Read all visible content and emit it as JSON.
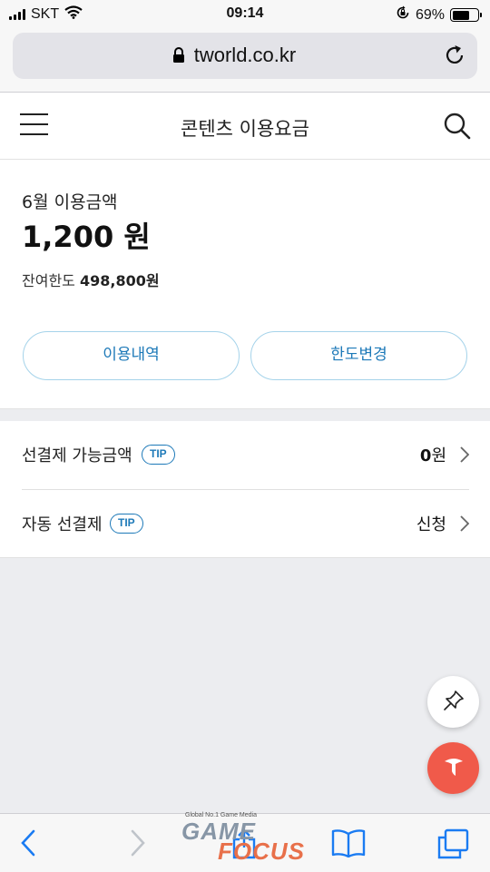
{
  "status_bar": {
    "carrier": "SKT",
    "time": "09:14",
    "battery_percent": "69%",
    "battery_level": 0.69,
    "icons": [
      "signal-icon",
      "wifi-icon",
      "rotation-lock-icon",
      "battery-icon"
    ]
  },
  "browser": {
    "url": "tworld.co.kr",
    "icons": [
      "lock-icon",
      "reload-icon"
    ]
  },
  "header": {
    "title": "콘텐츠 이용요금",
    "icons": [
      "menu-icon",
      "search-icon"
    ]
  },
  "usage": {
    "month_label": "6월 이용금액",
    "amount": "1,200 원",
    "remaining_label": "잔여한도",
    "remaining_value": "498,800원",
    "history_button": "이용내역",
    "limit_button": "한도변경"
  },
  "list": {
    "rows": [
      {
        "label": "선결제 가능금액",
        "badge": "TIP",
        "value_strong": "0",
        "value_unit": "원"
      },
      {
        "label": "자동 선결제",
        "badge": "TIP",
        "value_strong": "",
        "value_unit": "신청"
      }
    ]
  },
  "floating": {
    "icons": [
      "pin-icon",
      "tworld-logo-icon"
    ]
  },
  "toolbar": {
    "icons": [
      "back-icon",
      "forward-icon",
      "share-icon",
      "bookmarks-icon",
      "tabs-icon"
    ]
  },
  "watermark": {
    "tagline": "Global No.1 Game Media",
    "brand_top": "GAME",
    "brand_bottom": "FOCUS"
  },
  "colors": {
    "accent": "#1d79b8",
    "pill_border": "#a5d3ea",
    "fab_red": "#f05a4a",
    "page_bg": "#ecedf0"
  }
}
